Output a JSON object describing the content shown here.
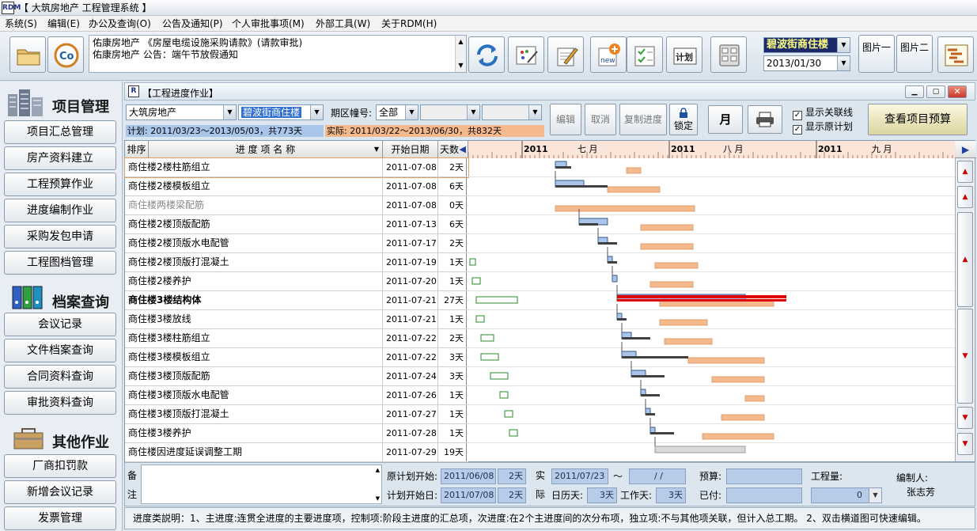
{
  "app": {
    "title": "【 大筑房地产 工程管理系统 】",
    "logo": "RDM"
  },
  "menu": [
    "系统(S)",
    "编辑(E)",
    "办公及查询(O)",
    "公告及通知(P)",
    "个人审批事项(M)",
    "外部工具(W)",
    "关于RDM(H)"
  ],
  "notice": {
    "line1": "佑康房地产 《房屋电缆设施采购请款》(请款审批)",
    "line2": "佑康房地产 公告：端午节放假通知"
  },
  "toolbar": {
    "project_select": "碧波街商住楼",
    "date": "2013/01/30",
    "pic_btn1": "图片一",
    "pic_btn2": "图片二",
    "new_label": "new",
    "plan_label": "计划"
  },
  "sidebar": {
    "section1": "项目管理",
    "items1": [
      "项目汇总管理",
      "房产资料建立",
      "工程预算作业",
      "进度编制作业",
      "采购发包申请",
      "工程图档管理"
    ],
    "section2": "档案查询",
    "items2": [
      "会议记录",
      "文件档案查询",
      "合同资料查询",
      "审批资料查询"
    ],
    "section3": "其他作业",
    "items3": [
      "厂商扣罚款",
      "新增会议记录",
      "发票管理"
    ]
  },
  "window": {
    "title": "【工程进度作业】",
    "logo": "R"
  },
  "controls": {
    "company": "大筑房地产",
    "project": "碧波街商住楼",
    "period_label": "期区幢号:",
    "period_value": "全部",
    "btn_edit": "编辑",
    "btn_cancel": "取消",
    "btn_copy": "复制进度",
    "btn_lock": "锁定",
    "btn_month": "月",
    "chk_relations": "显示关联线",
    "chk_original": "显示原计划",
    "btn_budget": "查看项目预算",
    "plan_text": "计划: 2011/03/23～2013/05/03，共773天",
    "actual_text": "实际: 2011/03/22～2013/06/30，共832天"
  },
  "grid": {
    "headers": {
      "order": "排序",
      "name": "进 度 项 名 称",
      "start": "开始日期",
      "days": "天数"
    },
    "months": [
      {
        "year": "2011",
        "month": "七 月"
      },
      {
        "year": "2011",
        "month": "八 月"
      },
      {
        "year": "2011",
        "month": "九 月"
      }
    ],
    "rows": [
      {
        "name": "商住楼2楼柱筋组立",
        "start": "2011-07-08",
        "days": "2天",
        "style": "normal"
      },
      {
        "name": "商住楼2楼模板组立",
        "start": "2011-07-08",
        "days": "6天",
        "style": "normal"
      },
      {
        "name": "商住楼两楼梁配筋",
        "start": "2011-07-08",
        "days": "0天",
        "style": "gray"
      },
      {
        "name": "商住楼2楼顶版配筋",
        "start": "2011-07-13",
        "days": "6天",
        "style": "normal"
      },
      {
        "name": "商住楼2楼顶版水电配管",
        "start": "2011-07-17",
        "days": "2天",
        "style": "normal"
      },
      {
        "name": "商住楼2楼顶版打混凝土",
        "start": "2011-07-19",
        "days": "1天",
        "style": "normal"
      },
      {
        "name": "商住楼2楼养护",
        "start": "2011-07-20",
        "days": "1天",
        "style": "normal"
      },
      {
        "name": "商住楼3楼结构体",
        "start": "2011-07-21",
        "days": "27天",
        "style": "bold"
      },
      {
        "name": "商住楼3楼放线",
        "start": "2011-07-21",
        "days": "1天",
        "style": "normal"
      },
      {
        "name": "商住楼3楼柱筋组立",
        "start": "2011-07-22",
        "days": "2天",
        "style": "normal"
      },
      {
        "name": "商住楼3楼模板组立",
        "start": "2011-07-22",
        "days": "3天",
        "style": "normal"
      },
      {
        "name": "商住楼3楼顶版配筋",
        "start": "2011-07-24",
        "days": "3天",
        "style": "normal"
      },
      {
        "name": "商住楼3楼顶版水电配管",
        "start": "2011-07-26",
        "days": "1天",
        "style": "normal"
      },
      {
        "name": "商住楼3楼顶版打混凝土",
        "start": "2011-07-27",
        "days": "1天",
        "style": "normal"
      },
      {
        "name": "商住楼3楼养护",
        "start": "2011-07-28",
        "days": "1天",
        "style": "normal"
      },
      {
        "name": "商住楼因进度延误调整工期",
        "start": "2011-07-29",
        "days": "19天",
        "style": "normal"
      }
    ]
  },
  "bottom": {
    "remark_label1": "备",
    "remark_label2": "注",
    "orig_start_label": "原计划开始:",
    "orig_start": "2011/06/08",
    "orig_days": "2天",
    "plan_start_label": "计划开始日:",
    "plan_start": "2011/07/08",
    "plan_days": "2天",
    "actual_label1": "实",
    "actual_label2": "际",
    "actual_start": "2011/07/23",
    "tilde": "～",
    "actual_end": "/ /",
    "cal_days_label": "日历天:",
    "cal_days": "3天",
    "work_days_label": "工作天:",
    "work_days": "3天",
    "budget_label": "预算:",
    "paid_label": "已付:",
    "qty_label": "工程量:",
    "qty_value": "0",
    "author_label": "编制人:",
    "author": "张志芳"
  },
  "status": "进度类説明：1、主进度:连贯全进度的主要进度项，控制项:阶段主进度的汇总项，次进度:在2个主进度间的次分布项，独立项:不与其他项关联，但计入总工期。  2、双击横道图可快速编辑。",
  "colors": {
    "plan_bar": "#a9c6ea",
    "actual_bar": "#f4b98c",
    "main_bar": "#e00000",
    "dark_bar": "#404040"
  }
}
